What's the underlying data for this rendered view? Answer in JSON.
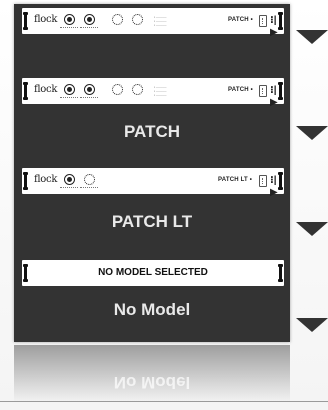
{
  "items": [
    {
      "brand": "flock",
      "model": "PATCH •",
      "caption": "",
      "knobs": [
        "filled",
        "filled",
        "dotted",
        "dotted"
      ]
    },
    {
      "brand": "flock",
      "model": "PATCH •",
      "caption": "PATCH",
      "knobs": [
        "filled",
        "filled",
        "dotted",
        "dotted"
      ]
    },
    {
      "brand": "flock",
      "model": "PATCH LT •",
      "caption": "PATCH LT",
      "knobs": [
        "filled",
        "dotted"
      ]
    },
    {
      "brand": "",
      "model": "NO MODEL SELECTED",
      "caption": "No Model",
      "knobs": []
    }
  ],
  "reflection": {
    "caption": "No Model"
  },
  "colors": {
    "panel": "#333333",
    "caption": "#e9e9e9",
    "rack": "#ffffff"
  },
  "icons": {
    "arrow": "chevron-down-arrow",
    "selector": "selector-switch",
    "connector": "connector-plug"
  }
}
